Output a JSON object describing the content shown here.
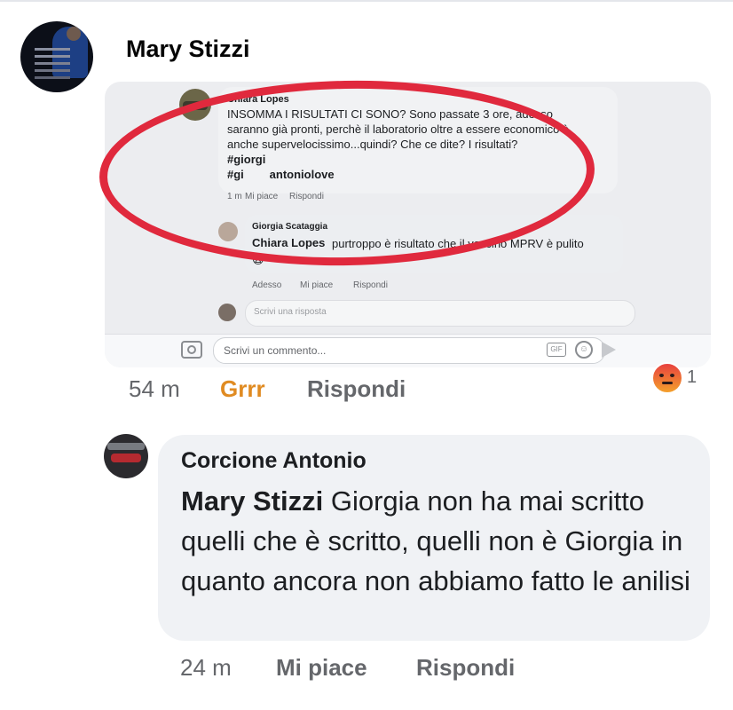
{
  "post": {
    "author": "Mary Stizzi",
    "time": "54 m",
    "reaction_label": "Grrr",
    "reply_label": "Rispondi",
    "reaction_count": "1",
    "reaction_icon": "angry-emoji-icon"
  },
  "screenshot": {
    "comment1": {
      "author": "Chiara Lopes",
      "lines": [
        "INSOMMA I RISULTATI CI SONO? Sono passate 3 ore, adesso",
        "saranno già pronti, perchè il laboratorio oltre a essere economico è",
        "anche supervelocissimo...quindi? Che ce dite? I risultati?",
        "#giorgi",
        "#gi        antoniolove"
      ],
      "time": "1 m",
      "like": "Mi piace",
      "reply": "Rispondi"
    },
    "comment2": {
      "author": "Giorgia Scataggia",
      "mention": "Chiara Lopes",
      "text": "purtroppo è risultato che il vaccino MPRV è pulito",
      "emoji": "😨",
      "time": "Adesso",
      "like": "Mi piace",
      "reply": "Rispondi"
    },
    "reply_placeholder": "Scrivi una risposta",
    "comment_placeholder": "Scrivi un commento...",
    "gif_label": "GIF"
  },
  "reply": {
    "author": "Corcione Antonio",
    "mention": "Mary Stizzi",
    "text": " Giorgia non ha mai scritto quelli che è scritto, quelli non è Giorgia in quanto ancora non abbiamo fatto le anilisi",
    "time": "24 m",
    "like": "Mi piace",
    "reply_label": "Rispondi"
  },
  "colors": {
    "ring": "#e0293d",
    "grrr": "#e08b22",
    "meta": "#65676b",
    "bubble": "#f0f2f5"
  }
}
